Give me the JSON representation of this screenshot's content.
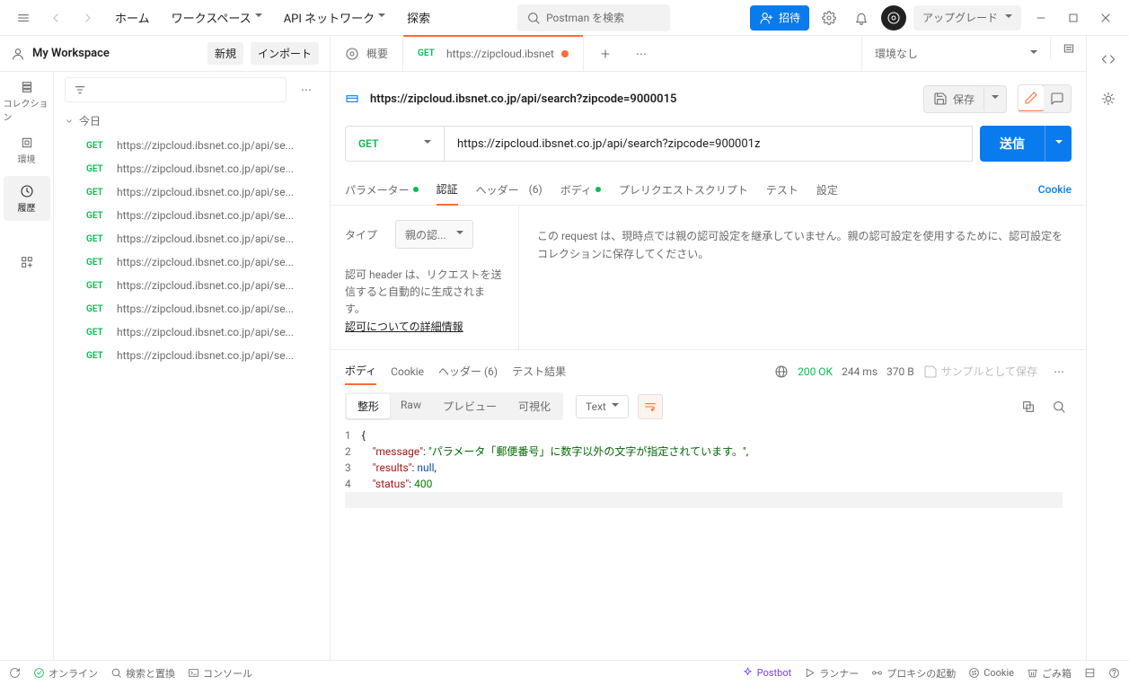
{
  "topbar": {
    "home": "ホーム",
    "workspace": "ワークスペース",
    "api_network": "API ネットワーク",
    "explore": "探索",
    "search_placeholder": "Postman を検索",
    "invite": "招待",
    "upgrade": "アップグレード"
  },
  "workspace": {
    "title": "My Workspace",
    "new": "新規",
    "import": "インポート"
  },
  "rail": {
    "collections": "コレクション",
    "env": "環境",
    "history": "履歴"
  },
  "history": {
    "group": "今日",
    "items": [
      {
        "method": "GET",
        "url": "https://zipcloud.ibsnet.co.jp/api/se..."
      },
      {
        "method": "GET",
        "url": "https://zipcloud.ibsnet.co.jp/api/se..."
      },
      {
        "method": "GET",
        "url": "https://zipcloud.ibsnet.co.jp/api/se..."
      },
      {
        "method": "GET",
        "url": "https://zipcloud.ibsnet.co.jp/api/se..."
      },
      {
        "method": "GET",
        "url": "https://zipcloud.ibsnet.co.jp/api/se..."
      },
      {
        "method": "GET",
        "url": "https://zipcloud.ibsnet.co.jp/api/se..."
      },
      {
        "method": "GET",
        "url": "https://zipcloud.ibsnet.co.jp/api/se..."
      },
      {
        "method": "GET",
        "url": "https://zipcloud.ibsnet.co.jp/api/se..."
      },
      {
        "method": "GET",
        "url": "https://zipcloud.ibsnet.co.jp/api/se..."
      },
      {
        "method": "GET",
        "url": "https://zipcloud.ibsnet.co.jp/api/se..."
      }
    ]
  },
  "tabs": {
    "overview": "概要",
    "active_method": "GET",
    "active_title": "https://zipcloud.ibsnet"
  },
  "env": {
    "none": "環境なし"
  },
  "request": {
    "title": "https://zipcloud.ibsnet.co.jp/api/search?zipcode=9000015",
    "save": "保存",
    "method": "GET",
    "url": "https://zipcloud.ibsnet.co.jp/api/search?zipcode=900001z",
    "send": "送信"
  },
  "req_tabs": {
    "params": "パラメーター",
    "auth": "認証",
    "headers": "ヘッダー",
    "headers_count": "(6)",
    "body": "ボディ",
    "prereq": "プレリクエストスクリプト",
    "tests": "テスト",
    "settings": "設定",
    "cookies": "Cookie"
  },
  "auth": {
    "type_label": "タイプ",
    "type_value": "親の認...",
    "note1": "認可 header は、リクエストを送信すると自動的に生成されます。",
    "learn": "認可についての詳細情報",
    "right_msg": "この request は、現時点では親の認可設定を継承していません。親の認可設定を使用するために、認可設定をコレクションに保存してください。"
  },
  "resp_tabs": {
    "body": "ボディ",
    "cookie": "Cookie",
    "headers": "ヘッダー",
    "headers_count": "(6)",
    "results": "テスト結果"
  },
  "resp_meta": {
    "status": "200 OK",
    "time": "244 ms",
    "size": "370 B",
    "save_sample": "サンプルとして保存"
  },
  "resp_view": {
    "pretty": "整形",
    "raw": "Raw",
    "preview": "プレビュー",
    "visualize": "可視化",
    "type": "Text"
  },
  "resp_body": {
    "l1": "{",
    "l2_key": "\"message\"",
    "l2_val": "\"パラメータ「郵便番号」に数字以外の文字が指定されています。\"",
    "l3_key": "\"results\"",
    "l3_val": "null",
    "l4_key": "\"status\"",
    "l4_val": "400",
    "l5": "}"
  },
  "footer": {
    "online": "オンライン",
    "find": "検索と置換",
    "console": "コンソール",
    "postbot": "Postbot",
    "runner": "ランナー",
    "proxy": "プロキシの起動",
    "cookie": "Cookie",
    "trash": "ごみ箱"
  }
}
